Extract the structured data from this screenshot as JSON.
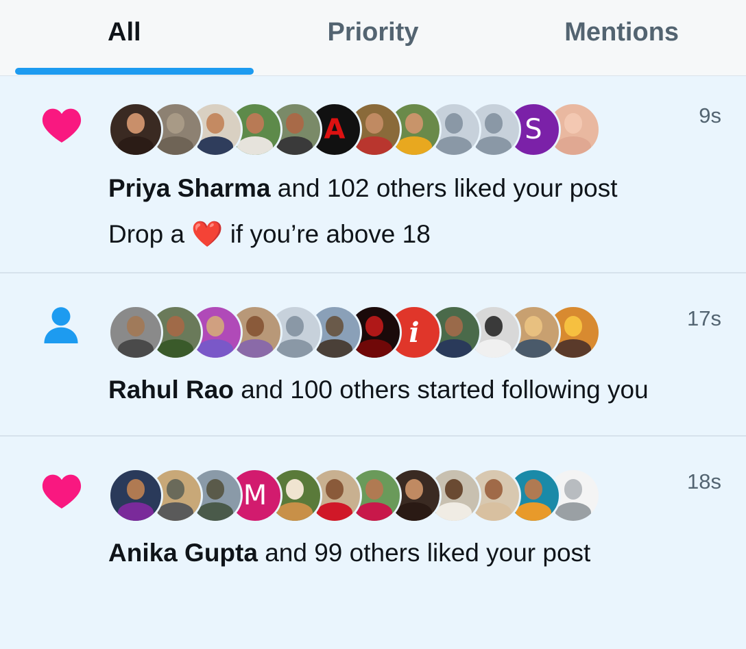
{
  "tabs": [
    {
      "label": "All",
      "active": true
    },
    {
      "label": "Priority",
      "active": false
    },
    {
      "label": "Mentions",
      "active": false
    }
  ],
  "notifications": [
    {
      "type": "like",
      "icon": "heart-icon",
      "time": "9s",
      "name": "Priya Sharma",
      "action": " and 102 others liked your post",
      "snippet_before": "Drop a ",
      "snippet_emoji": "❤️",
      "snippet_after": " if you’re above 18",
      "avatars": [
        {
          "kind": "photo",
          "bg": "#3a2a22",
          "face": "#c98f6a",
          "body": "#2b1c16"
        },
        {
          "kind": "photo",
          "bg": "#8d8172",
          "face": "#a89a86",
          "body": "#6f6456"
        },
        {
          "kind": "photo",
          "bg": "#d9d0c2",
          "face": "#c48a62",
          "body": "#2f3d5c"
        },
        {
          "kind": "photo",
          "bg": "#5d8a4a",
          "face": "#b87a55",
          "body": "#e6e3dc"
        },
        {
          "kind": "photo",
          "bg": "#7a8a68",
          "face": "#a86a48",
          "body": "#3a3a3a"
        },
        {
          "kind": "logo",
          "bg": "#111111",
          "letter": "A",
          "color": "#d11"
        },
        {
          "kind": "photo",
          "bg": "#8a6a3a",
          "face": "#c08a62",
          "body": "#b9362e"
        },
        {
          "kind": "photo",
          "bg": "#6a8a4a",
          "face": "#c8946a",
          "body": "#e8a81f"
        },
        {
          "kind": "default",
          "bg": "#c7d1db"
        },
        {
          "kind": "default",
          "bg": "#c7d1db"
        },
        {
          "kind": "letter",
          "bg": "#7b21a8",
          "letter": "S"
        },
        {
          "kind": "photo",
          "bg": "#e9b8a0",
          "face": "#f3c8b2",
          "body": "#e0a892"
        }
      ]
    },
    {
      "type": "follow",
      "icon": "person-icon",
      "time": "17s",
      "name": "Rahul Rao",
      "action": " and 100 others started following you",
      "avatars": [
        {
          "kind": "photo",
          "bg": "#8a8a8a",
          "face": "#a07a5a",
          "body": "#4a4a4a"
        },
        {
          "kind": "photo",
          "bg": "#6a7a5a",
          "face": "#a06a48",
          "body": "#3a5a2a"
        },
        {
          "kind": "photo",
          "bg": "#b04ab8",
          "face": "#d0a080",
          "body": "#7a58c8"
        },
        {
          "kind": "photo",
          "bg": "#b89878",
          "face": "#8a5a3a",
          "body": "#8a6aa8"
        },
        {
          "kind": "default",
          "bg": "#c7d1db"
        },
        {
          "kind": "photo",
          "bg": "#8aa0b8",
          "face": "#6a5a4a",
          "body": "#4a4038"
        },
        {
          "kind": "photo",
          "bg": "#1a0a0a",
          "face": "#b01818",
          "body": "#700808"
        },
        {
          "kind": "letter",
          "bg": "#e0362a",
          "letter": "i"
        },
        {
          "kind": "photo",
          "bg": "#4a6a4a",
          "face": "#9a6a4a",
          "body": "#2a3a5a"
        },
        {
          "kind": "photo",
          "bg": "#d8d8d8",
          "face": "#3a3a3a",
          "body": "#f0f0f0"
        },
        {
          "kind": "photo",
          "bg": "#c8a070",
          "face": "#e8c080",
          "body": "#4a5a6a"
        },
        {
          "kind": "photo",
          "bg": "#d88a30",
          "face": "#f6c040",
          "body": "#5a3a2a"
        }
      ]
    },
    {
      "type": "like",
      "icon": "heart-icon",
      "time": "18s",
      "name": "Anika Gupta",
      "action": " and 99 others liked your post",
      "avatars": [
        {
          "kind": "photo",
          "bg": "#2a3a5a",
          "face": "#b07a52",
          "body": "#7a2a9a"
        },
        {
          "kind": "photo",
          "bg": "#c8a878",
          "face": "#6a6a5a",
          "body": "#5a5a5a"
        },
        {
          "kind": "photo",
          "bg": "#8a9aa8",
          "face": "#5a5a4a",
          "body": "#4a5a4a"
        },
        {
          "kind": "letter",
          "bg": "#d21b6e",
          "letter": "M"
        },
        {
          "kind": "photo",
          "bg": "#5a7a3a",
          "face": "#f0e4d0",
          "body": "#c89048"
        },
        {
          "kind": "photo",
          "bg": "#c8b090",
          "face": "#8a5a3a",
          "body": "#d01828"
        },
        {
          "kind": "photo",
          "bg": "#6a9a5a",
          "face": "#b07a52",
          "body": "#c8184a"
        },
        {
          "kind": "photo",
          "bg": "#3a2a22",
          "face": "#c08a62",
          "body": "#2a1a14"
        },
        {
          "kind": "photo",
          "bg": "#c8c0b0",
          "face": "#6a4a32",
          "body": "#f0ece4"
        },
        {
          "kind": "photo",
          "bg": "#d8c8b0",
          "face": "#a06a48",
          "body": "#d8c0a0"
        },
        {
          "kind": "photo",
          "bg": "#1a8aa8",
          "face": "#b07a52",
          "body": "#e89a2a"
        },
        {
          "kind": "photo",
          "bg": "#f4f4f4",
          "face": "#b8bcc0",
          "body": "#9aa0a4"
        }
      ]
    }
  ]
}
